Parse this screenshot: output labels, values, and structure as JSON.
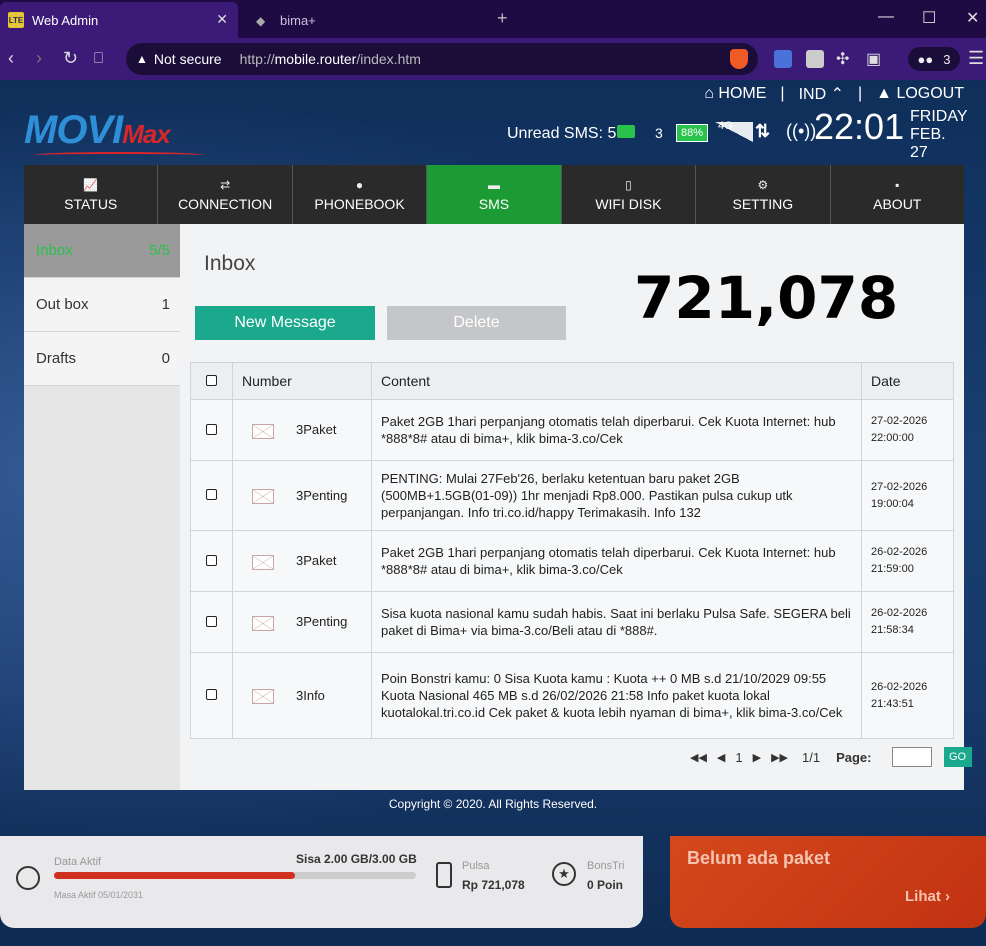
{
  "browser": {
    "active_tab": "Web Admin",
    "active_tab_favicon": "LTE",
    "inactive_tab": "bima+",
    "not_secure": "Not secure",
    "url_prefix": "http://",
    "url_host": "mobile.router",
    "url_path": "/index.htm",
    "shields_count": "3"
  },
  "header": {
    "logo_main": "MOVI",
    "logo_sub": "Max",
    "home": "HOME",
    "language": "IND",
    "logout": "LOGOUT",
    "unread_sms": "Unread SMS: 5",
    "carrier": "3",
    "battery": "88%",
    "network": "4G",
    "time": "22:01",
    "day": "FRIDAY",
    "date": "FEB. 27"
  },
  "tabs": [
    {
      "label": "STATUS",
      "icon": "chart-icon"
    },
    {
      "label": "CONNECTION",
      "icon": "swap-icon"
    },
    {
      "label": "PHONEBOOK",
      "icon": "person-icon"
    },
    {
      "label": "SMS",
      "icon": "message-icon"
    },
    {
      "label": "WIFI DISK",
      "icon": "disk-icon"
    },
    {
      "label": "SETTING",
      "icon": "gear-icon"
    },
    {
      "label": "ABOUT",
      "icon": "info-icon"
    }
  ],
  "sidebar": [
    {
      "label": "Inbox",
      "count": "5/5"
    },
    {
      "label": "Out box",
      "count": "1"
    },
    {
      "label": "Drafts",
      "count": "0"
    }
  ],
  "main": {
    "title": "Inbox",
    "overlay_number": "721,078",
    "new_message": "New Message",
    "delete": "Delete"
  },
  "table": {
    "headers": [
      "Number",
      "Content",
      "Date"
    ],
    "rows": [
      {
        "number": "3Paket",
        "content": "Paket 2GB 1hari perpanjang otomatis telah diperbarui. Cek Kuota Internet: hub *888*8# atau di bima+, klik bima-3.co/Cek",
        "date": "27-02-2026",
        "time": "22:00:00"
      },
      {
        "number": "3Penting",
        "content": "PENTING: Mulai 27Feb'26, berlaku ketentuan baru paket 2GB (500MB+1.5GB(01-09)) 1hr menjadi Rp8.000. Pastikan pulsa cukup utk perpanjangan. Info tri.co.id/happy Terimakasih. Info 132",
        "date": "27-02-2026",
        "time": "19:00:04"
      },
      {
        "number": "3Paket",
        "content": "Paket 2GB 1hari perpanjang otomatis telah diperbarui. Cek Kuota Internet: hub *888*8# atau di bima+, klik bima-3.co/Cek",
        "date": "26-02-2026",
        "time": "21:59:00"
      },
      {
        "number": "3Penting",
        "content": "Sisa kuota nasional kamu sudah habis. Saat ini berlaku Pulsa Safe. SEGERA beli paket di Bima+ via bima-3.co/Beli atau di *888#.",
        "date": "26-02-2026",
        "time": "21:58:34"
      },
      {
        "number": "3Info",
        "content": "Poin Bonstri kamu: 0 Sisa Kuota kamu : Kuota ++ 0 MB s.d 21/10/2029 09:55 Kuota Nasional 465 MB s.d 26/02/2026 21:58 Info paket kuota lokal kuotalokal.tri.co.id Cek paket & kuota lebih nyaman di bima+, klik bima-3.co/Cek",
        "date": "26-02-2026",
        "time": "21:43:51"
      }
    ]
  },
  "pager": {
    "current": "1",
    "total": "1/1",
    "page_label": "Page:",
    "go": "GO"
  },
  "footer": {
    "copyright": "Copyright © 2020. All Rights Reserved."
  },
  "bottom": {
    "data_label": "Data Aktif",
    "data_value": "Sisa 2.00 GB/3.00 GB",
    "data_fraction": 0.667,
    "masa_aktif": "Masa Aktif 05/01/2031",
    "pulsa_label": "Pulsa",
    "pulsa_value": "Rp 721,078",
    "bonstri_label": "BonsTri",
    "bonstri_value": "0 Poin",
    "promo_title": "Belum ada paket",
    "promo_link": "Lihat"
  }
}
